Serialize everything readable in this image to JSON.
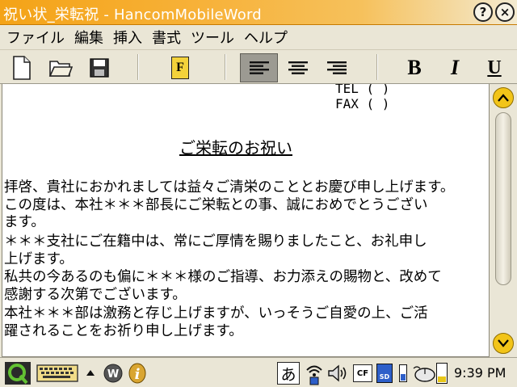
{
  "window": {
    "title": "祝い状_栄転祝 - HancomMobileWord",
    "help_label": "?",
    "close_label": "×"
  },
  "menu": {
    "items": [
      "ファイル",
      "編集",
      "挿入",
      "書式",
      "ツール",
      "ヘルプ"
    ]
  },
  "toolbar": {
    "new_icon": "new-document-icon",
    "open_icon": "open-folder-icon",
    "save_icon": "save-disk-icon",
    "font_label": "F",
    "align_left_active": true,
    "bold_label": "B",
    "italic_label": "I",
    "underline_label": "U"
  },
  "document": {
    "lines": [
      "TEL (   )",
      "FAX (   )",
      "ご栄転のお祝い",
      "拝啓、貴社におかれましては益々ご清栄のこととお慶び申し上げます。",
      "この度は、本社＊＊＊部長にご栄転との事、誠におめでとうござい",
      "ます。",
      "＊＊＊支社にご在籍中は、常にご厚情を賜りましたこと、お礼申し",
      "上げます。",
      "私共の今あるのも偏に＊＊＊様のご指導、お力添えの賜物と、改めて",
      "感謝する次第でございます。",
      "本社＊＊＊部は激務と存じ上げますが、いっそうご自愛の上、ご活",
      "躍されることをお祈り申し上げます。"
    ]
  },
  "scrollbar": {
    "position": 0.05
  },
  "taskbar": {
    "ime_label": "あ",
    "cf_label": "CF",
    "sd_label": "SD",
    "clock": "9:39 PM",
    "battery_level": 0.3
  },
  "colors": {
    "titlebar_start": "#f4a317",
    "scroll_button": "#f2c418",
    "active_tool": "#9c9a92"
  }
}
